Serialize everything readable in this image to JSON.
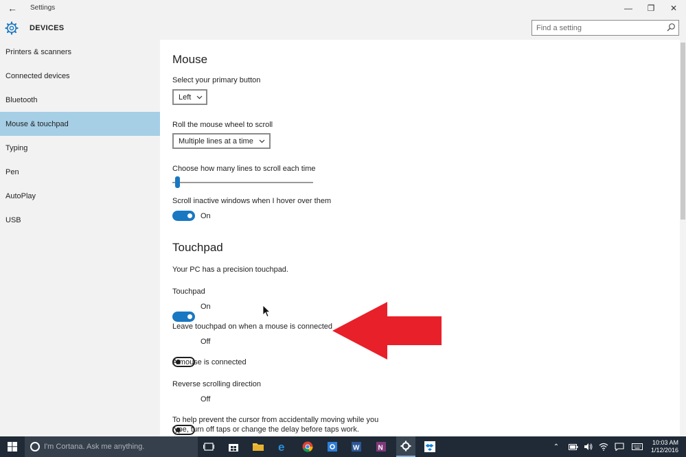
{
  "window": {
    "title": "Settings",
    "back_glyph": "←",
    "minimize_glyph": "—",
    "maximize_glyph": "❐",
    "close_glyph": "✕"
  },
  "header": {
    "title": "DEVICES",
    "search_placeholder": "Find a setting"
  },
  "sidebar": {
    "items": [
      {
        "label": "Printers & scanners"
      },
      {
        "label": "Connected devices"
      },
      {
        "label": "Bluetooth"
      },
      {
        "label": "Mouse & touchpad"
      },
      {
        "label": "Typing"
      },
      {
        "label": "Pen"
      },
      {
        "label": "AutoPlay"
      },
      {
        "label": "USB"
      }
    ]
  },
  "mouse": {
    "title": "Mouse",
    "primary_button_label": "Select your primary button",
    "primary_button_value": "Left",
    "wheel_label": "Roll the mouse wheel to scroll",
    "wheel_value": "Multiple lines at a time",
    "lines_label": "Choose how many lines to scroll each time",
    "lines_slider_fraction": 0.02,
    "inactive_label": "Scroll inactive windows when I hover over them",
    "inactive_state": "On"
  },
  "touchpad": {
    "title": "Touchpad",
    "precision_text": "Your PC has a precision touchpad.",
    "touchpad_label": "Touchpad",
    "touchpad_state": "On",
    "leave_on_label": "Leave touchpad on when a mouse is connected",
    "leave_on_state": "Off",
    "mouse_connected_text": "A mouse is connected",
    "reverse_label": "Reverse scrolling direction",
    "reverse_state": "Off",
    "help_line1": "To help prevent the cursor from accidentally moving while you",
    "help_line2": "type, turn off taps or change the delay before taps work."
  },
  "taskbar": {
    "cortana_placeholder": "I'm Cortana. Ask me anything.",
    "time": "10:03 AM",
    "date": "1/12/2016"
  },
  "colors": {
    "accent": "#1a78c2",
    "arrow": "#e8202a",
    "sidebar_active": "#a6cfe6"
  }
}
